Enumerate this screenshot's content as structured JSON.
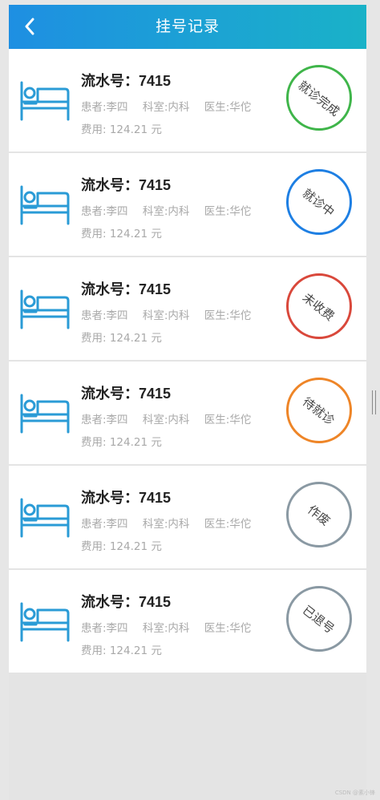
{
  "header": {
    "title": "挂号记录",
    "back_icon": "chevron-left-icon",
    "gradient_start": "#1e8fe2",
    "gradient_end": "#1ab2c8"
  },
  "records": [
    {
      "serial": "流水号：7415",
      "patient": "患者:李四",
      "dept": "科室:内科",
      "doctor": "医生:华佗",
      "fee": "费用:  124.21 元",
      "status": "就诊完成",
      "status_color": "#3fb54a"
    },
    {
      "serial": "流水号：7415",
      "patient": "患者:李四",
      "dept": "科室:内科",
      "doctor": "医生:华佗",
      "fee": "费用:  124.21 元",
      "status": "就诊中",
      "status_color": "#1e7fe3"
    },
    {
      "serial": "流水号：7415",
      "patient": "患者:李四",
      "dept": "科室:内科",
      "doctor": "医生:华佗",
      "fee": "费用:  124.21 元",
      "status": "未收费",
      "status_color": "#d9483b"
    },
    {
      "serial": "流水号：7415",
      "patient": "患者:李四",
      "dept": "科室:内科",
      "doctor": "医生:华佗",
      "fee": "费用:  124.21 元",
      "status": "待就诊",
      "status_color": "#ee8527"
    },
    {
      "serial": "流水号：7415",
      "patient": "患者:李四",
      "dept": "科室:内科",
      "doctor": "医生:华佗",
      "fee": "费用:  124.21 元",
      "status": "作废",
      "status_color": "#8a99a3"
    },
    {
      "serial": "流水号：7415",
      "patient": "患者:李四",
      "dept": "科室:内科",
      "doctor": "医生:华佗",
      "fee": "费用:  124.21 元",
      "status": "已退号",
      "status_color": "#8a99a3"
    }
  ],
  "icon": {
    "name": "hospital-bed-icon",
    "color": "#2a9bd6"
  },
  "watermark": "CSDN @素小锋"
}
